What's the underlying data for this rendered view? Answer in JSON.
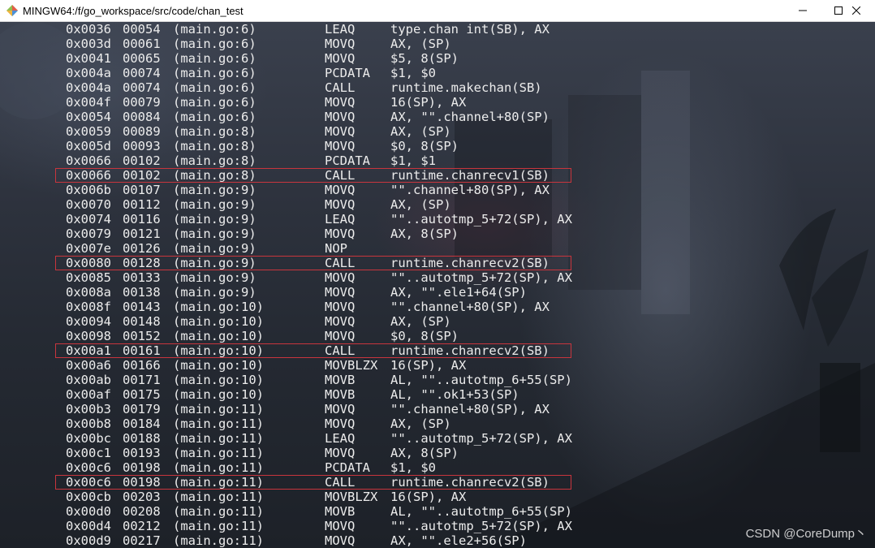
{
  "window": {
    "title": "MINGW64:/f/go_workspace/src/code/chan_test",
    "icons": {
      "app": "mingw-diamond-icon",
      "minimize": "minimize-icon",
      "maximize": "maximize-icon",
      "close": "close-icon"
    }
  },
  "colors": {
    "text": "#ececec",
    "highlight_box": "#c8353d",
    "titlebar": "#ffffff"
  },
  "lines": [
    {
      "addr": "0x0036",
      "off": "00054",
      "src": "(main.go:6)",
      "op": "LEAQ",
      "arg": "type.chan int(SB), AX",
      "highlight": false
    },
    {
      "addr": "0x003d",
      "off": "00061",
      "src": "(main.go:6)",
      "op": "MOVQ",
      "arg": "AX, (SP)",
      "highlight": false
    },
    {
      "addr": "0x0041",
      "off": "00065",
      "src": "(main.go:6)",
      "op": "MOVQ",
      "arg": "$5, 8(SP)",
      "highlight": false
    },
    {
      "addr": "0x004a",
      "off": "00074",
      "src": "(main.go:6)",
      "op": "PCDATA",
      "arg": "$1, $0",
      "highlight": false
    },
    {
      "addr": "0x004a",
      "off": "00074",
      "src": "(main.go:6)",
      "op": "CALL",
      "arg": "runtime.makechan(SB)",
      "highlight": false
    },
    {
      "addr": "0x004f",
      "off": "00079",
      "src": "(main.go:6)",
      "op": "MOVQ",
      "arg": "16(SP), AX",
      "highlight": false
    },
    {
      "addr": "0x0054",
      "off": "00084",
      "src": "(main.go:6)",
      "op": "MOVQ",
      "arg": "AX, \"\".channel+80(SP)",
      "highlight": false
    },
    {
      "addr": "0x0059",
      "off": "00089",
      "src": "(main.go:8)",
      "op": "MOVQ",
      "arg": "AX, (SP)",
      "highlight": false
    },
    {
      "addr": "0x005d",
      "off": "00093",
      "src": "(main.go:8)",
      "op": "MOVQ",
      "arg": "$0, 8(SP)",
      "highlight": false
    },
    {
      "addr": "0x0066",
      "off": "00102",
      "src": "(main.go:8)",
      "op": "PCDATA",
      "arg": "$1, $1",
      "highlight": false
    },
    {
      "addr": "0x0066",
      "off": "00102",
      "src": "(main.go:8)",
      "op": "CALL",
      "arg": "runtime.chanrecv1(SB)",
      "highlight": true
    },
    {
      "addr": "0x006b",
      "off": "00107",
      "src": "(main.go:9)",
      "op": "MOVQ",
      "arg": "\"\".channel+80(SP), AX",
      "highlight": false
    },
    {
      "addr": "0x0070",
      "off": "00112",
      "src": "(main.go:9)",
      "op": "MOVQ",
      "arg": "AX, (SP)",
      "highlight": false
    },
    {
      "addr": "0x0074",
      "off": "00116",
      "src": "(main.go:9)",
      "op": "LEAQ",
      "arg": "\"\"..autotmp_5+72(SP), AX",
      "highlight": false
    },
    {
      "addr": "0x0079",
      "off": "00121",
      "src": "(main.go:9)",
      "op": "MOVQ",
      "arg": "AX, 8(SP)",
      "highlight": false
    },
    {
      "addr": "0x007e",
      "off": "00126",
      "src": "(main.go:9)",
      "op": "NOP",
      "arg": "",
      "highlight": false
    },
    {
      "addr": "0x0080",
      "off": "00128",
      "src": "(main.go:9)",
      "op": "CALL",
      "arg": "runtime.chanrecv2(SB)",
      "highlight": true
    },
    {
      "addr": "0x0085",
      "off": "00133",
      "src": "(main.go:9)",
      "op": "MOVQ",
      "arg": "\"\"..autotmp_5+72(SP), AX",
      "highlight": false
    },
    {
      "addr": "0x008a",
      "off": "00138",
      "src": "(main.go:9)",
      "op": "MOVQ",
      "arg": "AX, \"\".ele1+64(SP)",
      "highlight": false
    },
    {
      "addr": "0x008f",
      "off": "00143",
      "src": "(main.go:10)",
      "op": "MOVQ",
      "arg": "\"\".channel+80(SP), AX",
      "highlight": false
    },
    {
      "addr": "0x0094",
      "off": "00148",
      "src": "(main.go:10)",
      "op": "MOVQ",
      "arg": "AX, (SP)",
      "highlight": false
    },
    {
      "addr": "0x0098",
      "off": "00152",
      "src": "(main.go:10)",
      "op": "MOVQ",
      "arg": "$0, 8(SP)",
      "highlight": false
    },
    {
      "addr": "0x00a1",
      "off": "00161",
      "src": "(main.go:10)",
      "op": "CALL",
      "arg": "runtime.chanrecv2(SB)",
      "highlight": true
    },
    {
      "addr": "0x00a6",
      "off": "00166",
      "src": "(main.go:10)",
      "op": "MOVBLZX",
      "arg": "16(SP), AX",
      "highlight": false
    },
    {
      "addr": "0x00ab",
      "off": "00171",
      "src": "(main.go:10)",
      "op": "MOVB",
      "arg": "AL, \"\"..autotmp_6+55(SP)",
      "highlight": false
    },
    {
      "addr": "0x00af",
      "off": "00175",
      "src": "(main.go:10)",
      "op": "MOVB",
      "arg": "AL, \"\".ok1+53(SP)",
      "highlight": false
    },
    {
      "addr": "0x00b3",
      "off": "00179",
      "src": "(main.go:11)",
      "op": "MOVQ",
      "arg": "\"\".channel+80(SP), AX",
      "highlight": false
    },
    {
      "addr": "0x00b8",
      "off": "00184",
      "src": "(main.go:11)",
      "op": "MOVQ",
      "arg": "AX, (SP)",
      "highlight": false
    },
    {
      "addr": "0x00bc",
      "off": "00188",
      "src": "(main.go:11)",
      "op": "LEAQ",
      "arg": "\"\"..autotmp_5+72(SP), AX",
      "highlight": false
    },
    {
      "addr": "0x00c1",
      "off": "00193",
      "src": "(main.go:11)",
      "op": "MOVQ",
      "arg": "AX, 8(SP)",
      "highlight": false
    },
    {
      "addr": "0x00c6",
      "off": "00198",
      "src": "(main.go:11)",
      "op": "PCDATA",
      "arg": "$1, $0",
      "highlight": false
    },
    {
      "addr": "0x00c6",
      "off": "00198",
      "src": "(main.go:11)",
      "op": "CALL",
      "arg": "runtime.chanrecv2(SB)",
      "highlight": true
    },
    {
      "addr": "0x00cb",
      "off": "00203",
      "src": "(main.go:11)",
      "op": "MOVBLZX",
      "arg": "16(SP), AX",
      "highlight": false
    },
    {
      "addr": "0x00d0",
      "off": "00208",
      "src": "(main.go:11)",
      "op": "MOVB",
      "arg": "AL, \"\"..autotmp_6+55(SP)",
      "highlight": false
    },
    {
      "addr": "0x00d4",
      "off": "00212",
      "src": "(main.go:11)",
      "op": "MOVQ",
      "arg": "\"\"..autotmp_5+72(SP), AX",
      "highlight": false
    },
    {
      "addr": "0x00d9",
      "off": "00217",
      "src": "(main.go:11)",
      "op": "MOVQ",
      "arg": "AX, \"\".ele2+56(SP)",
      "highlight": false
    }
  ],
  "watermark": "CSDN @CoreDump丶"
}
